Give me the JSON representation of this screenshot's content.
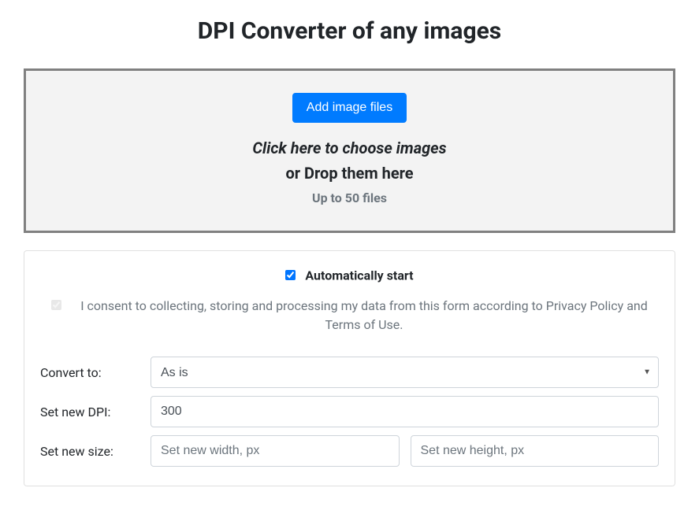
{
  "title": "DPI Converter of any images",
  "dropzone": {
    "button_label": "Add image files",
    "hint_click": "Click here to choose images",
    "hint_drop": "or Drop them here",
    "hint_limit": "Up to 50 files"
  },
  "options": {
    "auto_start_label": "Automatically start",
    "auto_start_checked": true,
    "consent_text": "I consent to collecting, storing and processing my data from this form according to Privacy Policy and Terms of Use.",
    "consent_checked": true
  },
  "form": {
    "convert_label": "Convert to:",
    "convert_value": "As is",
    "dpi_label": "Set new DPI:",
    "dpi_value": "300",
    "size_label": "Set new size:",
    "width_placeholder": "Set new width, px",
    "height_placeholder": "Set new height, px"
  }
}
